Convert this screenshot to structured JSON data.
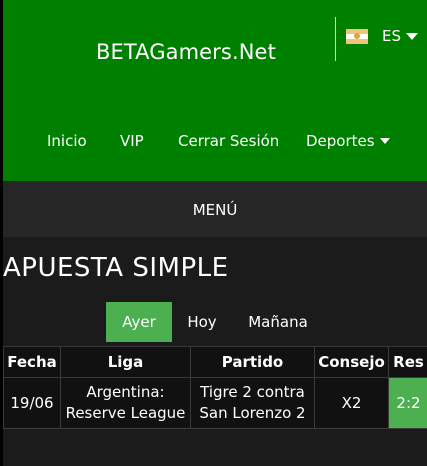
{
  "header": {
    "brand": "BETAGamers.Net",
    "language": {
      "label": "ES",
      "icon": "argentina-flag-icon"
    },
    "nav": [
      {
        "label": "Inicio"
      },
      {
        "label": "VIP"
      },
      {
        "label": "Cerrar Sesión"
      },
      {
        "label": "Deportes",
        "icon": "caret-down-icon"
      }
    ]
  },
  "menu": {
    "label": "MENÚ"
  },
  "page": {
    "title": "APUESTA SIMPLE",
    "tabs": [
      {
        "label": "Ayer",
        "active": true
      },
      {
        "label": "Hoy",
        "active": false
      },
      {
        "label": "Mañana",
        "active": false
      }
    ]
  },
  "table": {
    "columns": [
      "Fecha",
      "Liga",
      "Partido",
      "Consejo",
      "Res"
    ],
    "rows": [
      {
        "fecha": "19/06",
        "liga": [
          "Argentina:",
          "Reserve League"
        ],
        "partido": [
          "Tigre 2 contra",
          "San Lorenzo 2"
        ],
        "consejo": "X2",
        "res": "2:2"
      }
    ]
  },
  "colors": {
    "header_green": "#008000",
    "accent_green": "#4caf50",
    "menubar": "#262626",
    "background": "#1b1b1b"
  }
}
